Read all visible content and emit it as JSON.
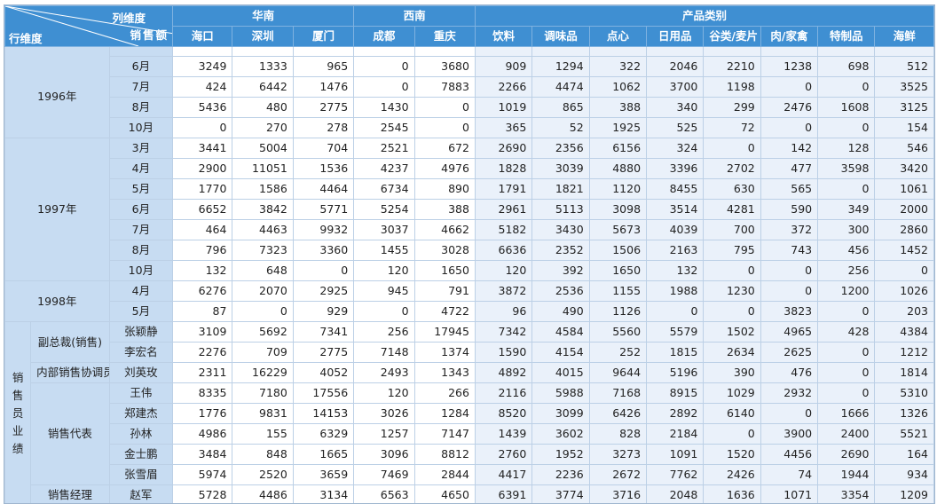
{
  "header": {
    "col_dim_label": "列维度",
    "row_dim_label": "行维度",
    "measure_label": "销售额",
    "groups": [
      "华南",
      "西南",
      "产品类别"
    ],
    "columns": [
      "海口",
      "深圳",
      "厦门",
      "成都",
      "重庆",
      "饮料",
      "调味品",
      "点心",
      "日用品",
      "谷类/麦片",
      "肉/家禽",
      "特制品",
      "海鲜"
    ]
  },
  "years": [
    {
      "label": "1996年",
      "rows": [
        {
          "month": "6月",
          "values": [
            "3249",
            "1333",
            "965",
            "0",
            "3680",
            "909",
            "1294",
            "322",
            "2046",
            "2210",
            "1238",
            "698",
            "512"
          ]
        },
        {
          "month": "7月",
          "values": [
            "424",
            "6442",
            "1476",
            "0",
            "7883",
            "2266",
            "4474",
            "1062",
            "3700",
            "1198",
            "0",
            "0",
            "3525"
          ]
        },
        {
          "month": "8月",
          "values": [
            "5436",
            "480",
            "2775",
            "1430",
            "0",
            "1019",
            "865",
            "388",
            "340",
            "299",
            "2476",
            "1608",
            "3125"
          ]
        },
        {
          "month": "10月",
          "values": [
            "0",
            "270",
            "278",
            "2545",
            "0",
            "365",
            "52",
            "1925",
            "525",
            "72",
            "0",
            "0",
            "154"
          ]
        }
      ]
    },
    {
      "label": "1997年",
      "rows": [
        {
          "month": "3月",
          "values": [
            "3441",
            "5004",
            "704",
            "2521",
            "672",
            "2690",
            "2356",
            "6156",
            "324",
            "0",
            "142",
            "128",
            "546"
          ]
        },
        {
          "month": "4月",
          "values": [
            "2900",
            "11051",
            "1536",
            "4237",
            "4976",
            "1828",
            "3039",
            "4880",
            "3396",
            "2702",
            "477",
            "3598",
            "3420"
          ]
        },
        {
          "month": "5月",
          "values": [
            "1770",
            "1586",
            "4464",
            "6734",
            "890",
            "1791",
            "1821",
            "1120",
            "8455",
            "630",
            "565",
            "0",
            "1061"
          ]
        },
        {
          "month": "6月",
          "values": [
            "6652",
            "3842",
            "5771",
            "5254",
            "388",
            "2961",
            "5113",
            "3098",
            "3514",
            "4281",
            "590",
            "349",
            "2000"
          ]
        },
        {
          "month": "7月",
          "values": [
            "464",
            "4463",
            "9932",
            "3037",
            "4662",
            "5182",
            "3430",
            "5673",
            "4039",
            "700",
            "372",
            "300",
            "2860"
          ]
        },
        {
          "month": "8月",
          "values": [
            "796",
            "7323",
            "3360",
            "1455",
            "3028",
            "6636",
            "2352",
            "1506",
            "2163",
            "795",
            "743",
            "456",
            "1452"
          ]
        },
        {
          "month": "10月",
          "values": [
            "132",
            "648",
            "0",
            "120",
            "1650",
            "120",
            "392",
            "1650",
            "132",
            "0",
            "0",
            "256",
            "0"
          ]
        }
      ]
    },
    {
      "label": "1998年",
      "rows": [
        {
          "month": "4月",
          "values": [
            "6276",
            "2070",
            "2925",
            "945",
            "791",
            "3872",
            "2536",
            "1155",
            "1988",
            "1230",
            "0",
            "1200",
            "1026"
          ]
        },
        {
          "month": "5月",
          "values": [
            "87",
            "0",
            "929",
            "0",
            "4722",
            "96",
            "490",
            "1126",
            "0",
            "0",
            "3823",
            "0",
            "203"
          ]
        }
      ]
    }
  ],
  "staff": {
    "label": [
      "销",
      "售",
      "员",
      "业",
      "绩"
    ],
    "roles": [
      {
        "title": "副总裁(销售)",
        "people": [
          {
            "name": "张颖静",
            "values": [
              "3109",
              "5692",
              "7341",
              "256",
              "17945",
              "7342",
              "4584",
              "5560",
              "5579",
              "1502",
              "4965",
              "428",
              "4384"
            ]
          },
          {
            "name": "李宏名",
            "values": [
              "2276",
              "709",
              "2775",
              "7148",
              "1374",
              "1590",
              "4154",
              "252",
              "1815",
              "2634",
              "2625",
              "0",
              "1212"
            ]
          }
        ]
      },
      {
        "title": "内部销售协调员",
        "people": [
          {
            "name": "刘英玫",
            "values": [
              "2311",
              "16229",
              "4052",
              "2493",
              "1343",
              "4892",
              "4015",
              "9644",
              "5196",
              "390",
              "476",
              "0",
              "1814"
            ]
          }
        ]
      },
      {
        "title": "销售代表",
        "people": [
          {
            "name": "王伟",
            "values": [
              "8335",
              "7180",
              "17556",
              "120",
              "266",
              "2116",
              "5988",
              "7168",
              "8915",
              "1029",
              "2932",
              "0",
              "5310"
            ]
          },
          {
            "name": "郑建杰",
            "values": [
              "1776",
              "9831",
              "14153",
              "3026",
              "1284",
              "8520",
              "3099",
              "6426",
              "2892",
              "6140",
              "0",
              "1666",
              "1326"
            ]
          },
          {
            "name": "孙林",
            "values": [
              "4986",
              "155",
              "6329",
              "1257",
              "7147",
              "1439",
              "3602",
              "828",
              "2184",
              "0",
              "3900",
              "2400",
              "5521"
            ]
          },
          {
            "name": "金士鹏",
            "values": [
              "3484",
              "848",
              "1665",
              "3096",
              "8812",
              "2760",
              "1952",
              "3273",
              "1091",
              "1520",
              "4456",
              "2690",
              "164"
            ]
          },
          {
            "name": "张雪眉",
            "values": [
              "5974",
              "2520",
              "3659",
              "7469",
              "2844",
              "4417",
              "2236",
              "2672",
              "7762",
              "2426",
              "74",
              "1944",
              "934"
            ]
          }
        ]
      },
      {
        "title": "销售经理",
        "people": [
          {
            "name": "赵军",
            "values": [
              "5728",
              "4486",
              "3134",
              "6563",
              "4650",
              "6391",
              "3774",
              "3716",
              "2048",
              "1636",
              "1071",
              "3354",
              "1209"
            ]
          }
        ]
      }
    ]
  }
}
